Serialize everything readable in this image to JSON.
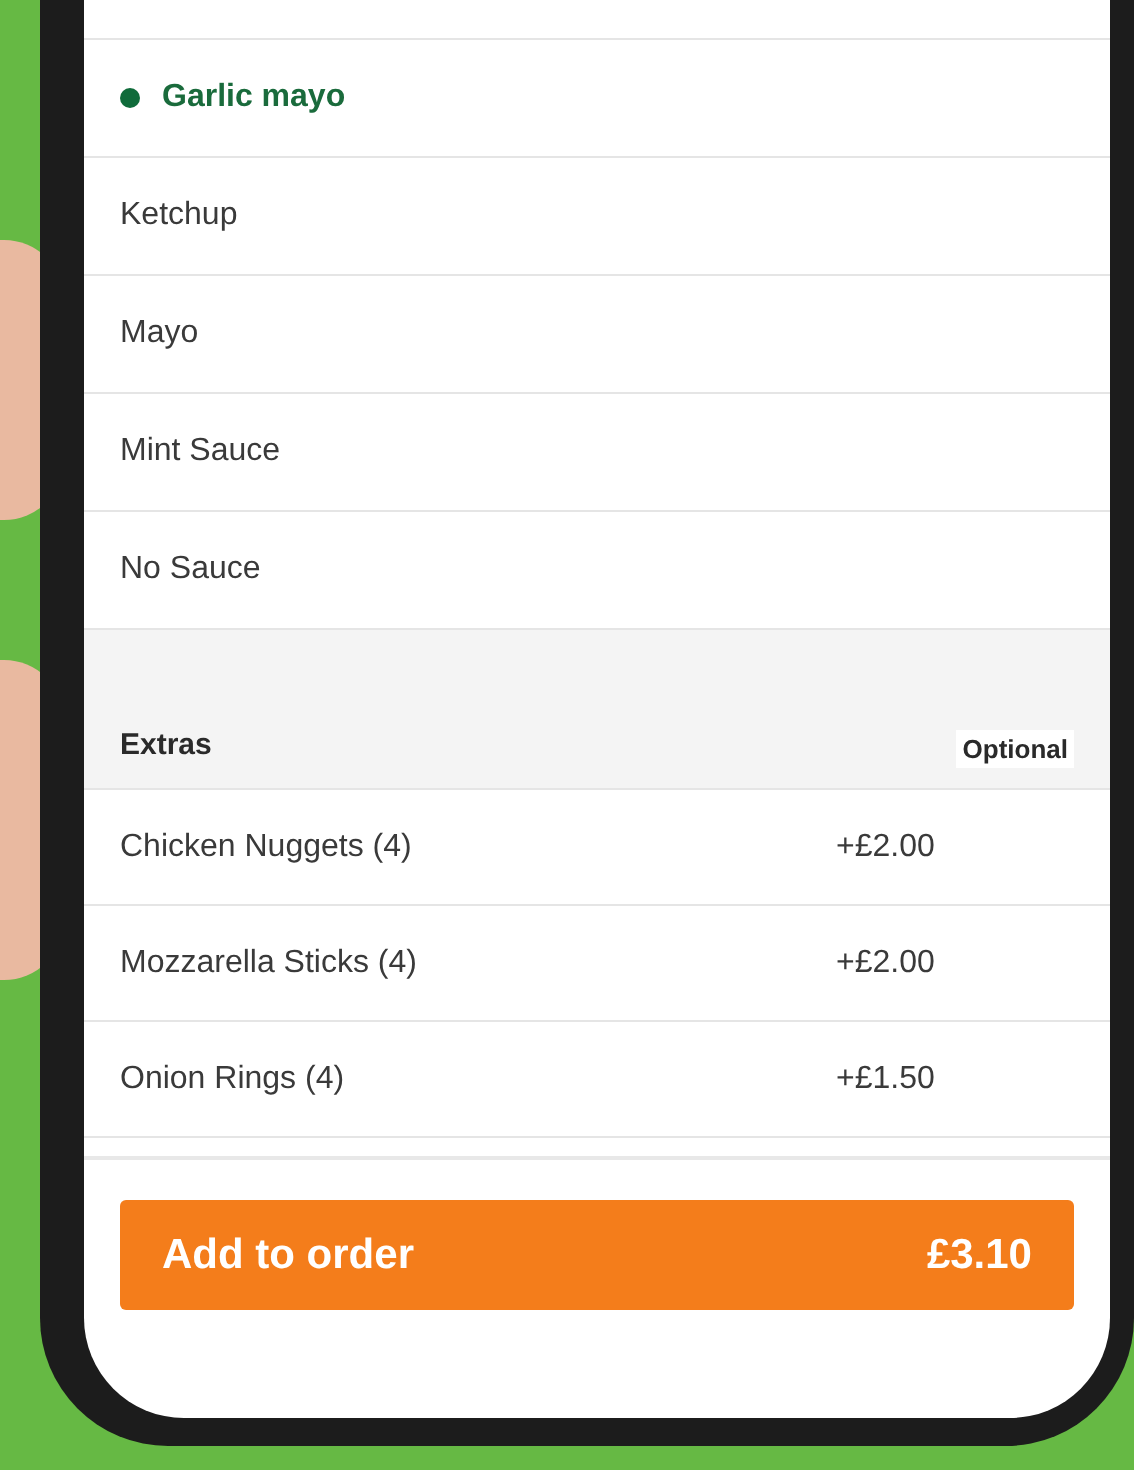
{
  "sauces": [
    {
      "label": "Garlic mayo",
      "selected": true
    },
    {
      "label": "Ketchup",
      "selected": false
    },
    {
      "label": "Mayo",
      "selected": false
    },
    {
      "label": "Mint Sauce",
      "selected": false
    },
    {
      "label": "No Sauce",
      "selected": false
    }
  ],
  "extras": {
    "title": "Extras",
    "badge": "Optional",
    "items": [
      {
        "label": "Chicken Nuggets (4)",
        "price": "+£2.00"
      },
      {
        "label": "Mozzarella Sticks (4)",
        "price": "+£2.00"
      },
      {
        "label": "Onion Rings (4)",
        "price": "+£1.50"
      }
    ]
  },
  "add_button": {
    "label": "Add to order",
    "price": "£3.10"
  }
}
